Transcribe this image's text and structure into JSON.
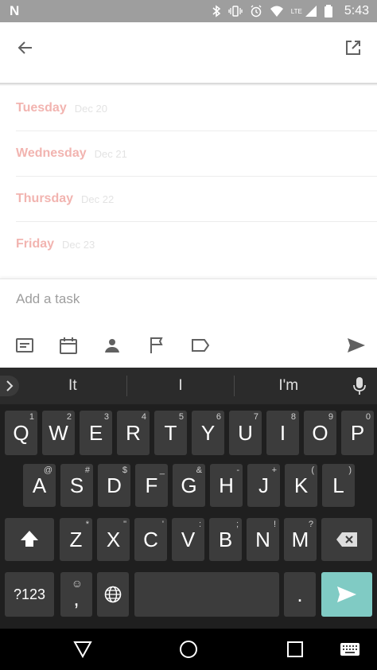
{
  "status_bar": {
    "logo": "N",
    "lte": "LTE",
    "time": "5:43"
  },
  "days": [
    {
      "name": "Tuesday",
      "date": "Dec 20"
    },
    {
      "name": "Wednesday",
      "date": "Dec 21"
    },
    {
      "name": "Thursday",
      "date": "Dec 22"
    },
    {
      "name": "Friday",
      "date": "Dec 23"
    }
  ],
  "task": {
    "placeholder": "Add a task"
  },
  "keyboard": {
    "suggestions": [
      "It",
      "I",
      "I'm"
    ],
    "row1": [
      [
        "Q",
        "1"
      ],
      [
        "W",
        "2"
      ],
      [
        "E",
        "3"
      ],
      [
        "R",
        "4"
      ],
      [
        "T",
        "5"
      ],
      [
        "Y",
        "6"
      ],
      [
        "U",
        "7"
      ],
      [
        "I",
        "8"
      ],
      [
        "O",
        "9"
      ],
      [
        "P",
        "0"
      ]
    ],
    "row2": [
      [
        "A",
        "@"
      ],
      [
        "S",
        "#"
      ],
      [
        "D",
        "$"
      ],
      [
        "F",
        "_"
      ],
      [
        "G",
        "&"
      ],
      [
        "H",
        "-"
      ],
      [
        "J",
        "+"
      ],
      [
        "K",
        "("
      ],
      [
        "L",
        ")"
      ]
    ],
    "row3": [
      [
        "Z",
        "*"
      ],
      [
        "X",
        "\""
      ],
      [
        "C",
        "'"
      ],
      [
        "V",
        ":"
      ],
      [
        "B",
        ";"
      ],
      [
        "N",
        "!"
      ],
      [
        "M",
        "?"
      ]
    ],
    "symbols_label": "?123",
    "comma_label": ",",
    "period_label": ".",
    "emoji_sup": "☺"
  },
  "colors": {
    "day_name": "#f2b4b0",
    "send_key": "#80cbc4",
    "status_bar": "#9e9e9e"
  }
}
